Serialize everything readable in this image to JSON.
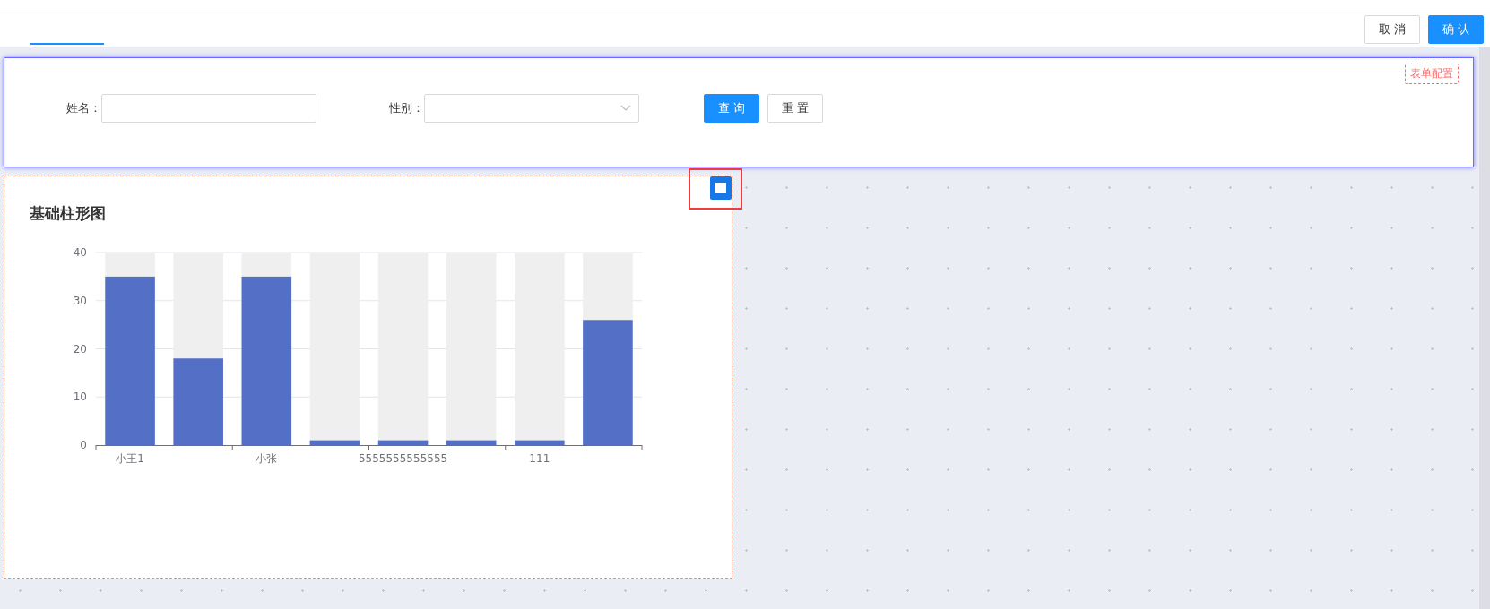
{
  "top_bar": {
    "tabs": [
      {
        "selected": true
      }
    ],
    "buttons": [
      {
        "label": "取 消",
        "kind": "default"
      },
      {
        "label": "确 认",
        "kind": "primary"
      }
    ]
  },
  "search_form": {
    "config_tag": "表单配置",
    "fields": [
      {
        "label": "姓名：",
        "kind": "input"
      },
      {
        "label": "性别：",
        "kind": "select"
      }
    ],
    "buttons": [
      {
        "label": "查 询",
        "kind": "primary"
      },
      {
        "label": "重 置",
        "kind": "default"
      }
    ]
  },
  "chart_card": {
    "title": "基础柱形图",
    "chart_data": {
      "type": "bar",
      "ylim": [
        0,
        40
      ],
      "yticks": [
        0,
        10,
        20,
        30,
        40
      ],
      "grid": true,
      "categories": [
        "小王1",
        null,
        "小张",
        null,
        "5555555555555",
        null,
        "111",
        null
      ],
      "series": [
        {
          "color": "#5470c6",
          "values": [
            35,
            18,
            35,
            1,
            1,
            1,
            1,
            26
          ]
        }
      ]
    }
  }
}
